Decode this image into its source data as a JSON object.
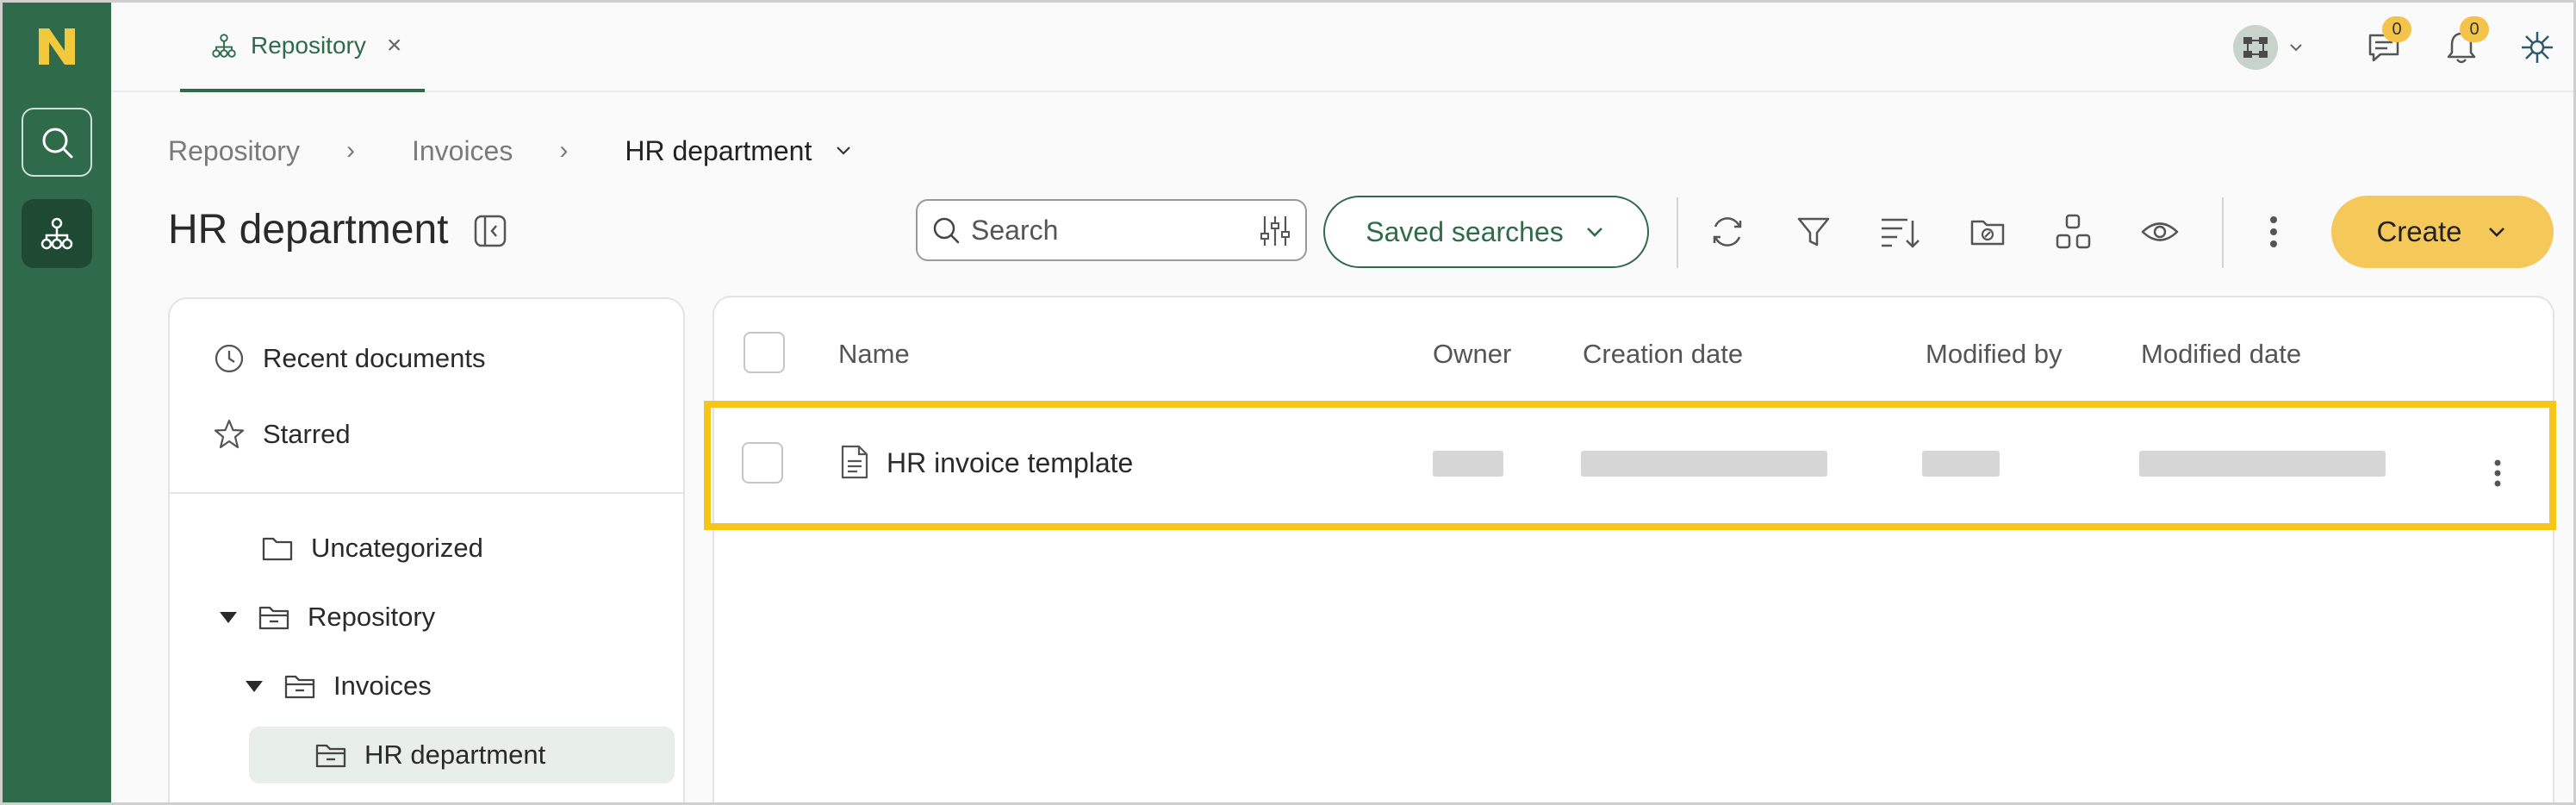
{
  "colors": {
    "brand_green": "#2f6b4b",
    "accent_yellow": "#f5c85a",
    "highlight_yellow": "#f5c518"
  },
  "rail": {
    "logo_icon": "n-logo-icon",
    "search_icon": "search-icon",
    "repository_icon": "hierarchy-icon"
  },
  "topbar": {
    "tab_label": "Repository",
    "tab_close": "×",
    "messages_badge": "0",
    "notifications_badge": "0"
  },
  "breadcrumb": {
    "items": [
      "Repository",
      "Invoices"
    ],
    "separator": "›",
    "current": "HR department"
  },
  "header": {
    "title": "HR department",
    "search_placeholder": "Search",
    "saved_searches_label": "Saved searches",
    "create_label": "Create"
  },
  "tree": {
    "quick": [
      {
        "label": "Recent documents",
        "icon": "clock-icon"
      },
      {
        "label": "Starred",
        "icon": "star-icon"
      }
    ],
    "folders": [
      {
        "label": "Uncategorized",
        "expanded": false
      },
      {
        "label": "Repository",
        "expanded": true
      },
      {
        "label": "Invoices",
        "expanded": true
      },
      {
        "label": "HR department",
        "selected": true
      }
    ]
  },
  "table": {
    "columns": [
      "Name",
      "Owner",
      "Creation date",
      "Modified by",
      "Modified date"
    ],
    "rows": [
      {
        "name": "HR invoice template",
        "icon": "document-icon"
      }
    ]
  }
}
